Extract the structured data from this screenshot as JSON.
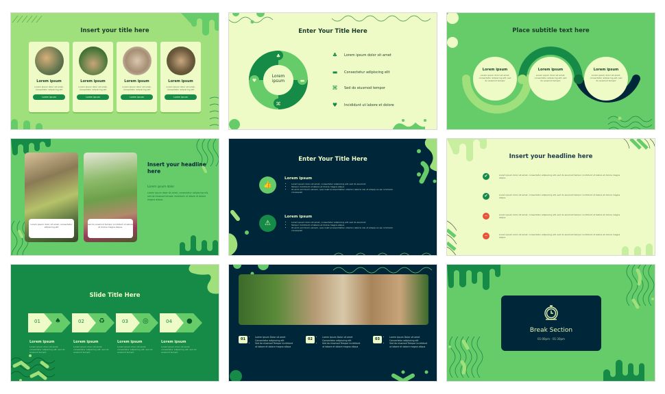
{
  "slides": [
    {
      "title": "Insert your title here",
      "cards": [
        {
          "heading": "Lorem ipsum",
          "body": "Lorem ipsum dolor sit amet, consectetur adipiscing elit",
          "button": "Lorem ipsum"
        },
        {
          "heading": "Lorem ipsum",
          "body": "Lorem ipsum dolor sit amet, consectetur adipiscing elit",
          "button": "Lorem ipsum"
        },
        {
          "heading": "Lorem ipsum",
          "body": "Lorem ipsum dolor sit amet, consectetur adipiscing elit",
          "button": "Lorem ipsum"
        },
        {
          "heading": "Lorem ipsum",
          "body": "Lorem ipsum dolor sit amet, consectetur adipiscing elit",
          "button": "Lorem ipsum"
        }
      ]
    },
    {
      "title": "Enter Your Title Here",
      "center_label": "Lorem ipsum",
      "items": [
        {
          "icon": "people-icon",
          "glyph": "♣",
          "text": "Lorem ipsum dolor sit amet"
        },
        {
          "icon": "recycle-truck-icon",
          "glyph": "▬",
          "text": "Consectetur adipiscing elit"
        },
        {
          "icon": "network-icon",
          "glyph": "⌘",
          "text": "Sed do eiusmod tempor"
        },
        {
          "icon": "handshake-icon",
          "glyph": "♥",
          "text": "Incididunt ut labore et dolore"
        }
      ]
    },
    {
      "title": "Place subtitle text here",
      "circles": [
        {
          "heading": "Lorem ipsum",
          "body": "Lorem ipsum dolor sit amet, consectetur adipiscing elit, sed do eiusmod tempor"
        },
        {
          "heading": "Lorem ipsum",
          "body": "Lorem ipsum dolor sit amet, consectetur adipiscing elit, sed do eiusmod tempor"
        },
        {
          "heading": "Lorem ipsum",
          "body": "Lorem ipsum dolor sit amet, consectetur adipiscing elit, sed do eiusmod tempor"
        }
      ]
    },
    {
      "headline": "Insert your headline here",
      "subheading": "Lorem ipsum dolor",
      "body": "Lorem ipsum dolor sit amet, consectetur adipiscing elit, sed do eiusmod tempor incididunt ut labore et dolore magna aliqua.",
      "bubbles": [
        "Lorem ipsum dolor sit amet, consectetur adipiscing elit",
        "sed do eiusmod tempor incididunt ut labore et dolore magna aliqua."
      ]
    },
    {
      "title": "Enter Your Title Here",
      "rows": [
        {
          "icon": "thumbs-up-icon",
          "glyph": "👍",
          "heading": "Lorem ipsum",
          "bullets": [
            "Lorem ipsum dolor sit amet, consectetur adipiscing elit, sed do eiusmod",
            "Tempor incididunt ut labore et dolore magna aliqua",
            "Ut enim ad minim veniam, quis nostrud exercitation ullamco laboris nisi ut aliquip ex ea commodo consequat."
          ]
        },
        {
          "icon": "warning-icon",
          "glyph": "⚠",
          "heading": "Lorem ipsum",
          "bullets": [
            "Lorem ipsum dolor sit amet, consectetur adipiscing elit, sed do eiusmod",
            "Tempor incididunt ut labore et dolore magna aliqua",
            "Ut enim ad minim veniam, quis nostrud exercitation ullamco laboris nisi ut aliquip ex ea commodo consequat."
          ]
        }
      ]
    },
    {
      "title": "Insert your headline here",
      "rows": [
        {
          "status": "check",
          "glyph": "✔",
          "color": "#168a47",
          "text": "Lorem ipsum dolor sit amet, consectetur adipiscing elit, sed do eiusmod tempor incididunt ut labore et dolore magna aliqua."
        },
        {
          "status": "check",
          "glyph": "✔",
          "color": "#168a47",
          "text": "Lorem ipsum dolor sit amet, consectetur adipiscing elit, sed do eiusmod tempor incididunt ut labore et dolore magna aliqua."
        },
        {
          "status": "minus",
          "glyph": "−",
          "color": "#e8533a",
          "text": "Lorem ipsum dolor sit amet, consectetur adipiscing elit, sed do eiusmod tempor incididunt ut labore et dolore magna aliqua."
        },
        {
          "status": "minus",
          "glyph": "−",
          "color": "#e8533a",
          "text": "Lorem ipsum dolor sit amet, consectetur adipiscing elit, sed do eiusmod tempor incididunt ut labore et dolore magna aliqua."
        }
      ]
    },
    {
      "title": "Slide Title Here",
      "steps": [
        {
          "num": "01",
          "icon": "hand-plant-icon",
          "glyph": "♠",
          "heading": "Lorem ipsum",
          "body": "Lorem ipsum dolor sit amet, consectetur adipiscing elit, sed do eiusmod tempor"
        },
        {
          "num": "02",
          "icon": "recycle-icon",
          "glyph": "♻",
          "heading": "Lorem ipsum",
          "body": "Lorem ipsum dolor sit amet, consectetur adipiscing elit, sed do eiusmod tempor"
        },
        {
          "num": "03",
          "icon": "compass-icon",
          "glyph": "◎",
          "heading": "Lorem ipsum",
          "body": "Lorem ipsum dolor sit amet, consectetur adipiscing elit, sed do eiusmod tempor"
        },
        {
          "num": "04",
          "icon": "globe-plant-icon",
          "glyph": "●",
          "heading": "Lorem ipsum",
          "body": "Lorem ipsum dolor sit amet, consectetur adipiscing elit, sed do eiusmod tempor"
        }
      ]
    },
    {
      "columns": [
        {
          "num": "01",
          "bullets": [
            "Lorem Ipsum Dolor sit amet Consectetur adipiscing elit",
            "Sed do eiusmod Tempor incididunt ut labore et dolore magna aliqua"
          ]
        },
        {
          "num": "02",
          "bullets": [
            "Lorem Ipsum Dolor sit amet Consectetur adipiscing elit",
            "Sed do eiusmod Tempor incididunt ut labore et dolore magna aliqua"
          ]
        },
        {
          "num": "03",
          "bullets": [
            "Lorem Ipsum Dolor sit amet Consectetur adipiscing elit",
            "Sed do eiusmod Tempor incididunt ut labore et dolore magna aliqua"
          ]
        }
      ]
    },
    {
      "title": "Break Section",
      "time": "01:00pm - 01:30pm"
    }
  ]
}
